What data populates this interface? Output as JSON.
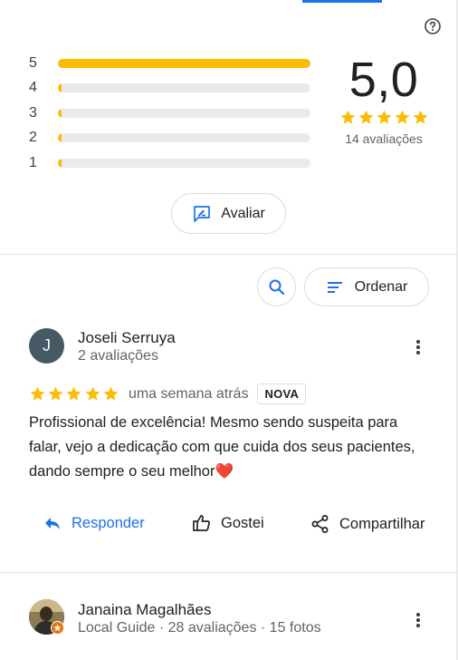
{
  "summary": {
    "help_icon": "help-circle-icon",
    "bars": [
      {
        "label": "5",
        "fraction": 1.0
      },
      {
        "label": "4",
        "fraction": 0.0
      },
      {
        "label": "3",
        "fraction": 0.0
      },
      {
        "label": "2",
        "fraction": 0.0
      },
      {
        "label": "1",
        "fraction": 0.0
      }
    ],
    "score": "5,0",
    "stars": 5,
    "count_label": "14 avaliações",
    "rate_button": "Avaliar"
  },
  "toolbar": {
    "search_icon": "search-icon",
    "sort_label": "Ordenar"
  },
  "reviews": [
    {
      "avatar_letter": "J",
      "name": "Joseli Serruya",
      "meta": "2 avaliações",
      "stars": 5,
      "time": "uma semana atrás",
      "badge": "NOVA",
      "text": "Profissional de excelência! Mesmo sendo suspeita para falar, vejo a dedicação com que cuida dos seus pacientes, dando sempre o seu melhor❤️",
      "actions": {
        "reply": "Responder",
        "like": "Gostei",
        "share": "Compartilhar"
      }
    },
    {
      "name": "Janaina Magalhães",
      "meta": "Local Guide · 28 avaliações · 15 fotos"
    }
  ],
  "colors": {
    "accent": "#1a73e8",
    "star": "#fbbc04",
    "avatar_bg": "#455a64",
    "badge_orange": "#e8710a"
  }
}
